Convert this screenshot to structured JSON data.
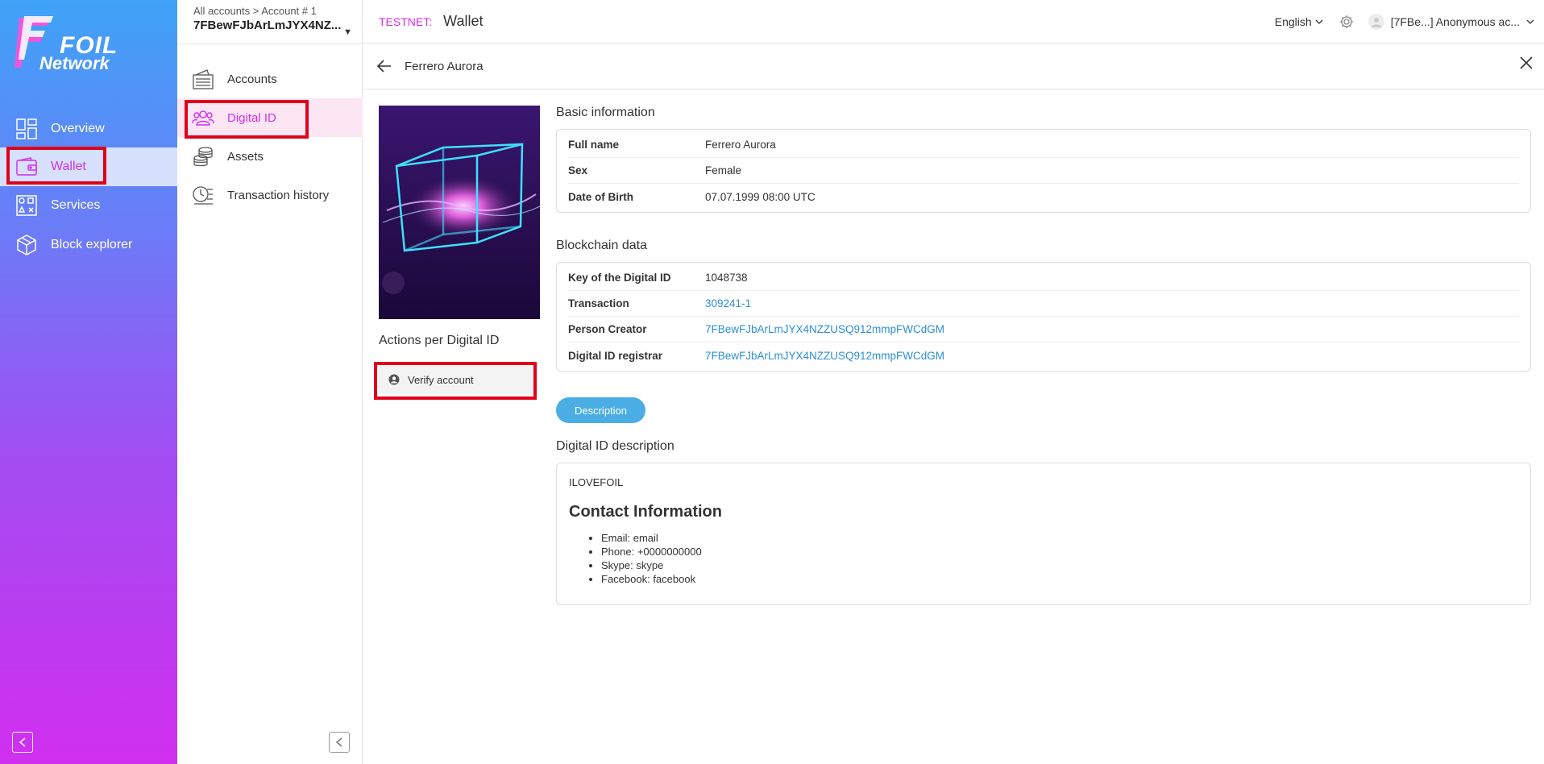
{
  "brand": {
    "name": "FOIL",
    "subname": "Network",
    "colors": {
      "accent": "#d12ff0",
      "link": "#2b8fd6",
      "button": "#4aaee5",
      "highlight": "#e0001a"
    }
  },
  "main_nav": {
    "items": [
      {
        "label": "Overview",
        "icon": "overview-icon"
      },
      {
        "label": "Wallet",
        "icon": "wallet-icon",
        "active": true
      },
      {
        "label": "Services",
        "icon": "services-icon"
      },
      {
        "label": "Block explorer",
        "icon": "block-explorer-icon"
      }
    ]
  },
  "account": {
    "breadcrumb": "All accounts > Account # 1",
    "address": "7FBewFJbArLmJYX4NZ..."
  },
  "sub_nav": {
    "items": [
      {
        "label": "Accounts",
        "icon": "accounts-icon"
      },
      {
        "label": "Digital ID",
        "icon": "digital-id-icon",
        "active": true
      },
      {
        "label": "Assets",
        "icon": "assets-icon"
      },
      {
        "label": "Transaction history",
        "icon": "transaction-history-icon"
      }
    ]
  },
  "topbar": {
    "network": "TESTNET:",
    "title": "Wallet",
    "language": "English",
    "user": "[7FBe...] Anonymous ac..."
  },
  "detail": {
    "title": "Ferrero Aurora",
    "actions_title": "Actions per Digital ID",
    "verify_label": "Verify account",
    "basic": {
      "title": "Basic information",
      "rows": [
        {
          "key": "Full name",
          "value": "Ferrero Aurora"
        },
        {
          "key": "Sex",
          "value": "Female"
        },
        {
          "key": "Date of Birth",
          "value": "07.07.1999 08:00 UTC"
        }
      ]
    },
    "blockchain": {
      "title": "Blockchain data",
      "rows": [
        {
          "key": "Key of the Digital ID",
          "value": "1048738"
        },
        {
          "key": "Transaction",
          "value": "309241-1"
        },
        {
          "key": "Person Creator",
          "value": "7FBewFJbArLmJYX4NZZUSQ912mmpFWCdGM"
        },
        {
          "key": "Digital ID registrar",
          "value": "7FBewFJbArLmJYX4NZZUSQ912mmpFWCdGM"
        }
      ]
    },
    "description_button": "Description",
    "description": {
      "title": "Digital ID description",
      "first_line": "ILOVEFOIL",
      "heading": "Contact Information",
      "items": [
        "Email: email",
        "Phone: +0000000000",
        "Skype: skype",
        "Facebook: facebook"
      ]
    }
  }
}
